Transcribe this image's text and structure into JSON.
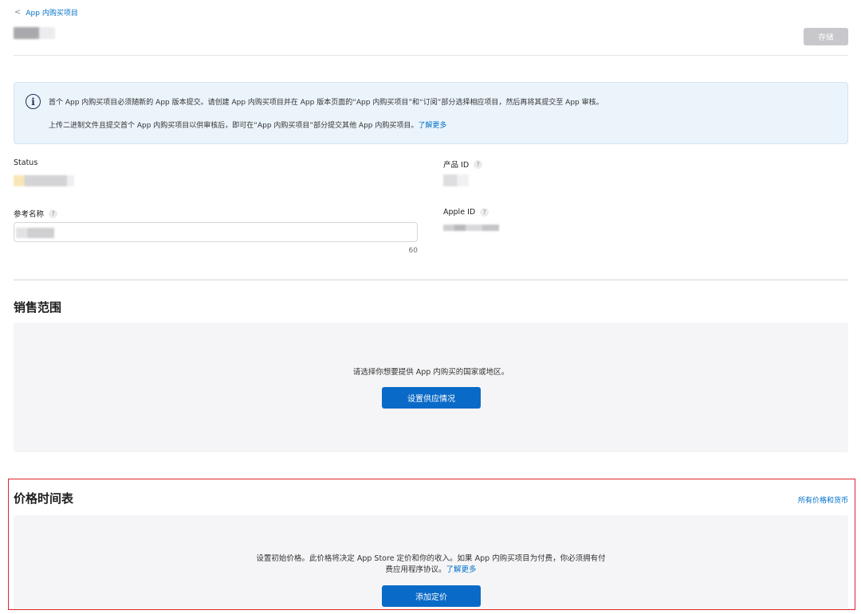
{
  "nav": {
    "back_label": "App 内购买项目",
    "back_chevron": "<"
  },
  "header": {
    "save_label": "存储"
  },
  "notice": {
    "icon": "i",
    "line1": "首个 App 内购买项目必须随新的 App 版本提交。请创建 App 内购买项目并在 App 版本页面的“App 内购买项目”和“订阅”部分选择相应项目，然后再将其提交至 App 审核。",
    "line2": "上传二进制文件且提交首个 App 内购买项目以供审核后，即可在“App 内购买项目”部分提交其他 App 内购买项目。",
    "line2_link": "了解更多"
  },
  "fields": {
    "status_label": "Status",
    "product_id_label": "产品 ID",
    "ref_name_label": "参考名称",
    "apple_id_label": "Apple ID",
    "help_mark": "?",
    "char_count": "60"
  },
  "availability": {
    "title": "销售范围",
    "prompt": "请选择你想要提供 App 内购买的国家或地区。",
    "button": "设置供应情况"
  },
  "pricing": {
    "title": "价格时间表",
    "all_prices_link": "所有价格和货币",
    "text_line1": "设置初始价格。此价格将决定 App Store 定价和你的收入。如果 App 内购买项目为付费，你必须拥有付",
    "text_line2": "费应用程序协议。",
    "text_link": "了解更多",
    "button": "添加定价"
  },
  "colors": {
    "accent": "#0070c9",
    "button_primary": "#0a6ac7",
    "highlight": "#e0232b",
    "notice_bg": "#ebf4fb",
    "panel_bg": "#f5f5f7"
  }
}
